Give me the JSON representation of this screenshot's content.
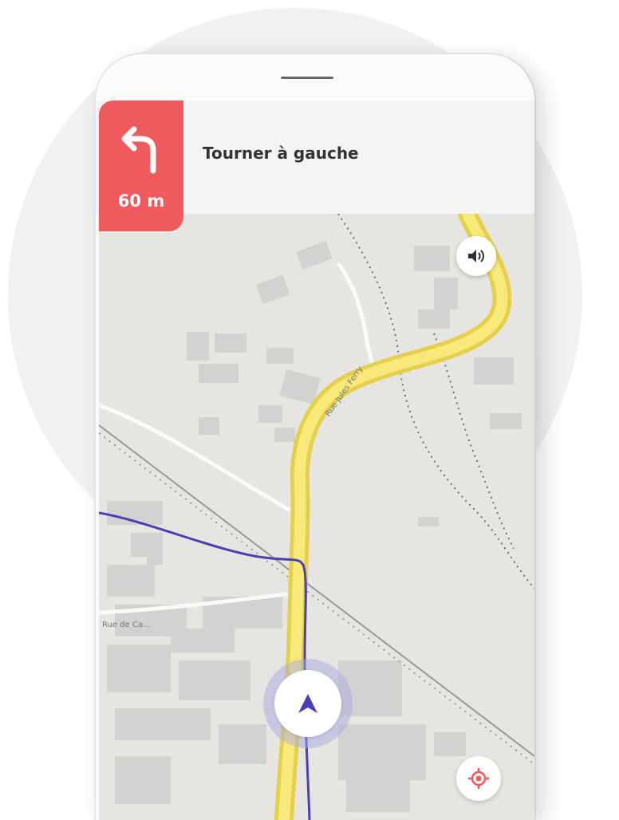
{
  "navigation": {
    "instruction": "Tourner à gauche",
    "distance": "60 m"
  },
  "map": {
    "street_label_1": "Rue de Ca...",
    "street_label_2": "Rue Jules Ferry"
  },
  "icons": {
    "turn": "turn-left-arrow-icon",
    "sound": "speaker-icon",
    "position": "navigation-arrow-icon",
    "locate": "crosshair-icon"
  },
  "colors": {
    "accent": "#ee5a5e",
    "route": "#f3dd5c",
    "track": "#4b3fb3"
  }
}
